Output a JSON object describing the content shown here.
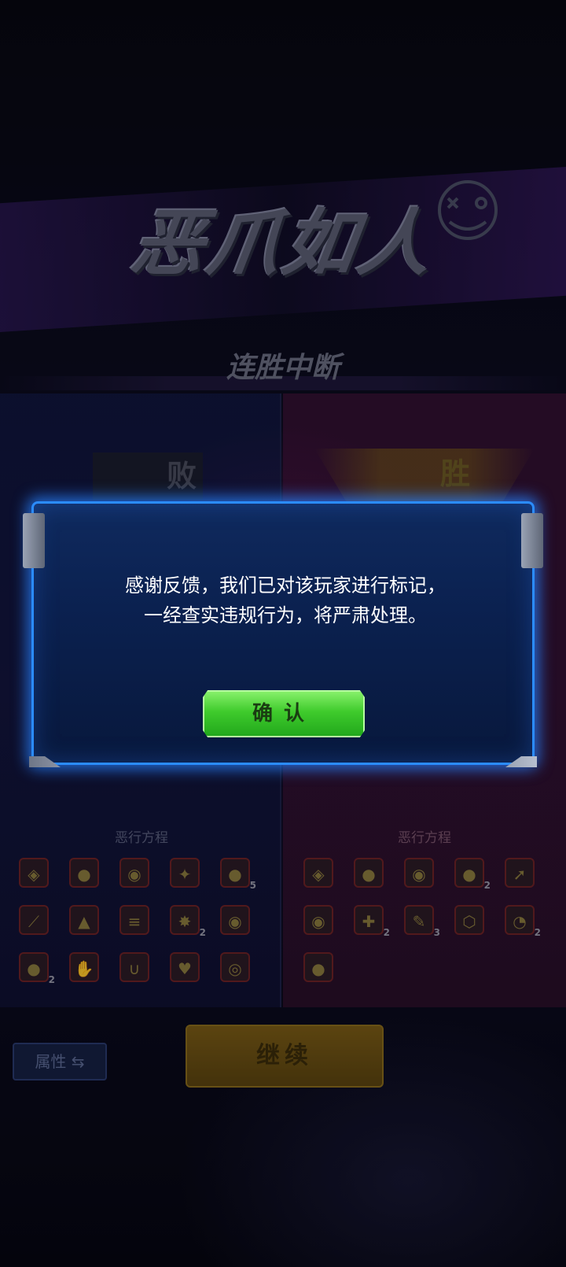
{
  "header": {
    "title": "恶爪如人",
    "subtitle": "连胜中断"
  },
  "result": {
    "lose_label": "败",
    "win_label": "胜"
  },
  "left_panel": {
    "section_label": "恶行方程",
    "icons": [
      {
        "name": "gem-icon",
        "glyph": "◈",
        "count": ""
      },
      {
        "name": "coin-face-icon",
        "glyph": "●",
        "count": ""
      },
      {
        "name": "pet-face-icon",
        "glyph": "◉",
        "count": ""
      },
      {
        "name": "pikachu-icon",
        "glyph": "✦",
        "count": ""
      },
      {
        "name": "coins-icon",
        "glyph": "●",
        "count": "5"
      },
      {
        "name": "slash-icon",
        "glyph": "⟋",
        "count": ""
      },
      {
        "name": "warning-icon",
        "glyph": "▲",
        "count": ""
      },
      {
        "name": "claw-icon",
        "glyph": "≡",
        "count": ""
      },
      {
        "name": "burst-icon",
        "glyph": "✸",
        "count": "2"
      },
      {
        "name": "beast-face-icon",
        "glyph": "◉",
        "count": ""
      },
      {
        "name": "coin-icon",
        "glyph": "●",
        "count": "2"
      },
      {
        "name": "gauntlet-icon",
        "glyph": "✋",
        "count": ""
      },
      {
        "name": "magnet-icon",
        "glyph": "∪",
        "count": ""
      },
      {
        "name": "heart-gem-icon",
        "glyph": "♥",
        "count": ""
      },
      {
        "name": "target-icon",
        "glyph": "◎",
        "count": ""
      }
    ]
  },
  "right_panel": {
    "section_label": "恶行方程",
    "icons": [
      {
        "name": "gem-icon",
        "glyph": "◈",
        "count": ""
      },
      {
        "name": "coin-face-icon",
        "glyph": "●",
        "count": ""
      },
      {
        "name": "pet-face-icon",
        "glyph": "◉",
        "count": ""
      },
      {
        "name": "coins-icon",
        "glyph": "●",
        "count": "2"
      },
      {
        "name": "rocket-icon",
        "glyph": "➚",
        "count": ""
      },
      {
        "name": "beast-face-icon",
        "glyph": "◉",
        "count": ""
      },
      {
        "name": "plus-icon",
        "glyph": "✚",
        "count": "2"
      },
      {
        "name": "tools-icon",
        "glyph": "✎",
        "count": "3"
      },
      {
        "name": "shield-icon",
        "glyph": "⬡",
        "count": ""
      },
      {
        "name": "speed-icon",
        "glyph": "◔",
        "count": "2"
      },
      {
        "name": "coin-icon",
        "glyph": "●",
        "count": ""
      }
    ]
  },
  "controls": {
    "attr_label": "属性 ⇆",
    "continue_label": "继续"
  },
  "dialog": {
    "message_line1": "感谢反馈，我们已对该玩家进行标记，",
    "message_line2": "一经查实违规行为，将严肃处理。",
    "confirm_label": "确认"
  }
}
